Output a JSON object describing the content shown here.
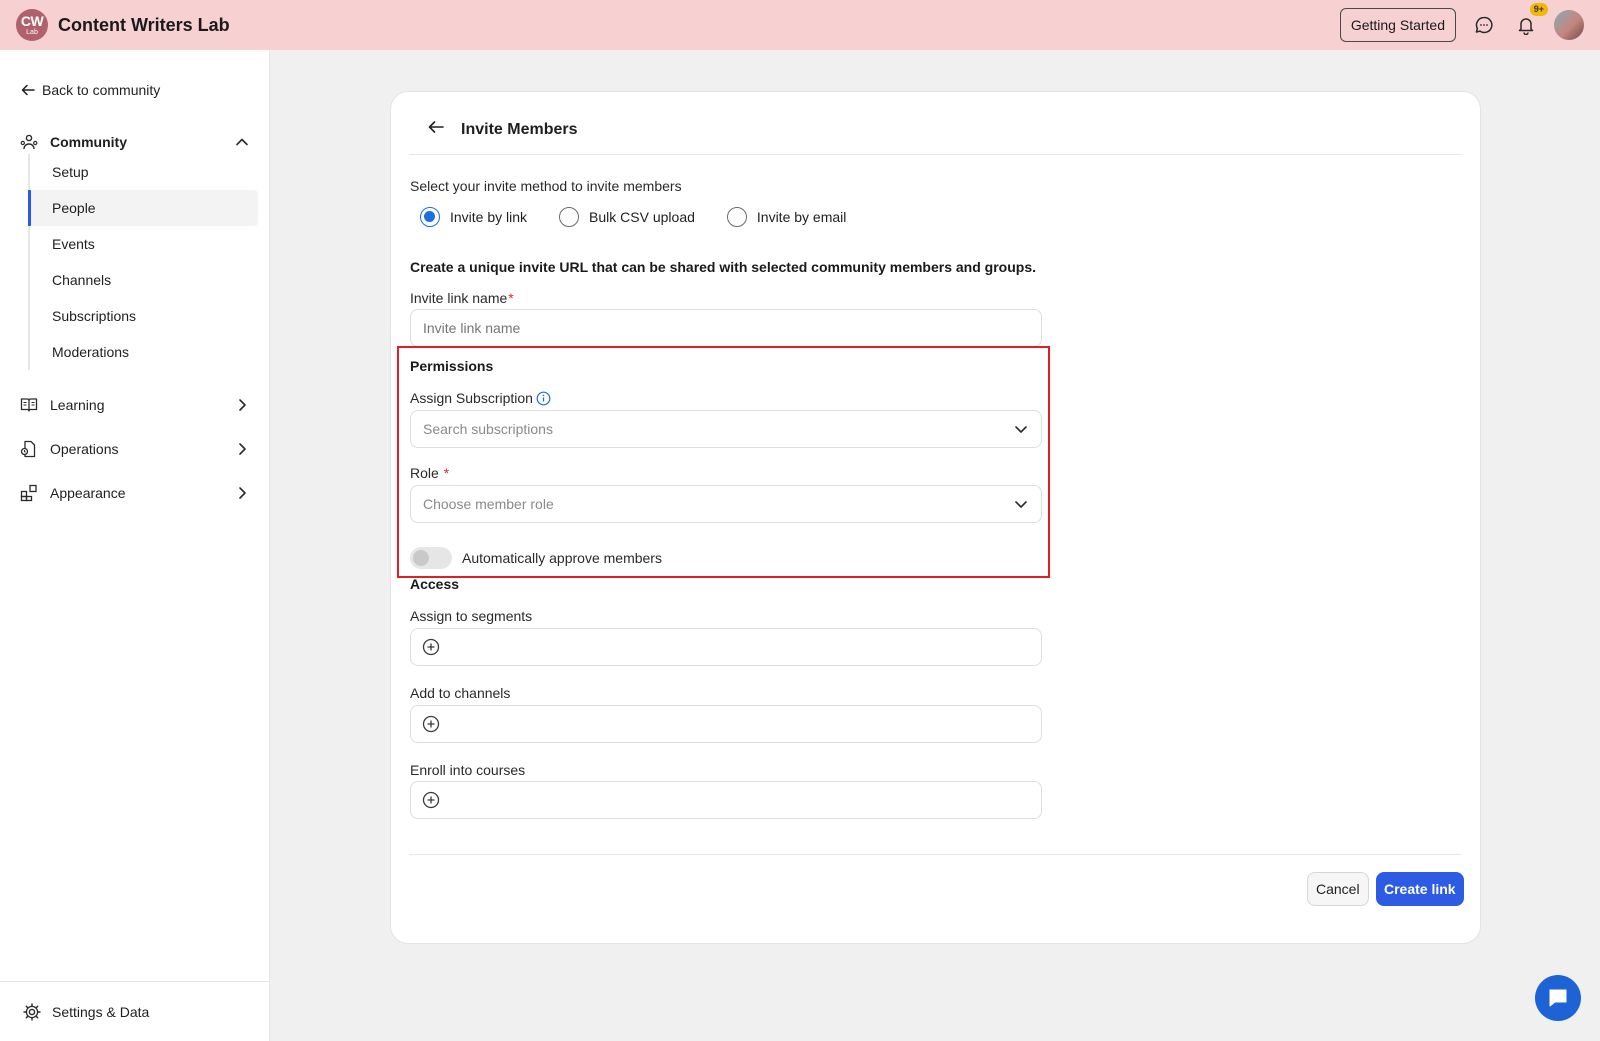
{
  "topbar": {
    "logo_line1": "CW",
    "logo_line2": "Lab",
    "app_title": "Content Writers Lab",
    "getting_started_label": "Getting Started",
    "notification_badge": "9+"
  },
  "sidebar": {
    "back_label": "Back to community",
    "community_label": "Community",
    "community_items": [
      {
        "label": "Setup",
        "active": false
      },
      {
        "label": "People",
        "active": true
      },
      {
        "label": "Events",
        "active": false
      },
      {
        "label": "Channels",
        "active": false
      },
      {
        "label": "Subscriptions",
        "active": false
      },
      {
        "label": "Moderations",
        "active": false
      }
    ],
    "learning_label": "Learning",
    "operations_label": "Operations",
    "appearance_label": "Appearance",
    "settings_label": "Settings & Data"
  },
  "invite": {
    "title": "Invite Members",
    "method_prompt": "Select your invite method to invite members",
    "methods": [
      {
        "label": "Invite by link",
        "selected": true
      },
      {
        "label": "Bulk CSV upload",
        "selected": false
      },
      {
        "label": "Invite by email",
        "selected": false
      }
    ],
    "description": "Create a unique invite URL that can be shared with selected community members and groups.",
    "link_name_label": "Invite link name",
    "link_name_placeholder": "Invite link name",
    "required_mark": "*",
    "permissions_title": "Permissions",
    "subscription_label": "Assign Subscription",
    "subscription_placeholder": "Search subscriptions",
    "role_label": "Role",
    "role_placeholder": "Choose member role",
    "auto_approve_label": "Automatically approve members",
    "auto_approve_on": false,
    "access_title": "Access",
    "segments_label": "Assign to segments",
    "channels_label": "Add to channels",
    "courses_label": "Enroll into courses",
    "cancel_label": "Cancel",
    "create_label": "Create link"
  },
  "colors": {
    "topbar_bg": "#f7d0d2",
    "accent": "#2d5be3",
    "radio_selected": "#1b6fe0",
    "highlight_border": "#e01e24"
  }
}
